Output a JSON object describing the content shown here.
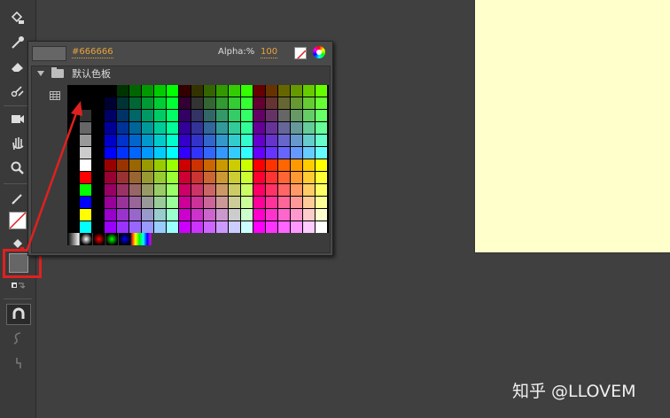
{
  "color_picker": {
    "hex_value": "#666666",
    "alpha_label": "Alpha:%",
    "alpha_value": "100",
    "swatch_folder_label": "默认色板"
  },
  "current_fill_color": "#666666",
  "watermark": "知乎 @LLOVEM",
  "colors": {
    "stage": "#ffffcc",
    "accent_text": "#e8a33a",
    "highlight": "#e02020"
  }
}
